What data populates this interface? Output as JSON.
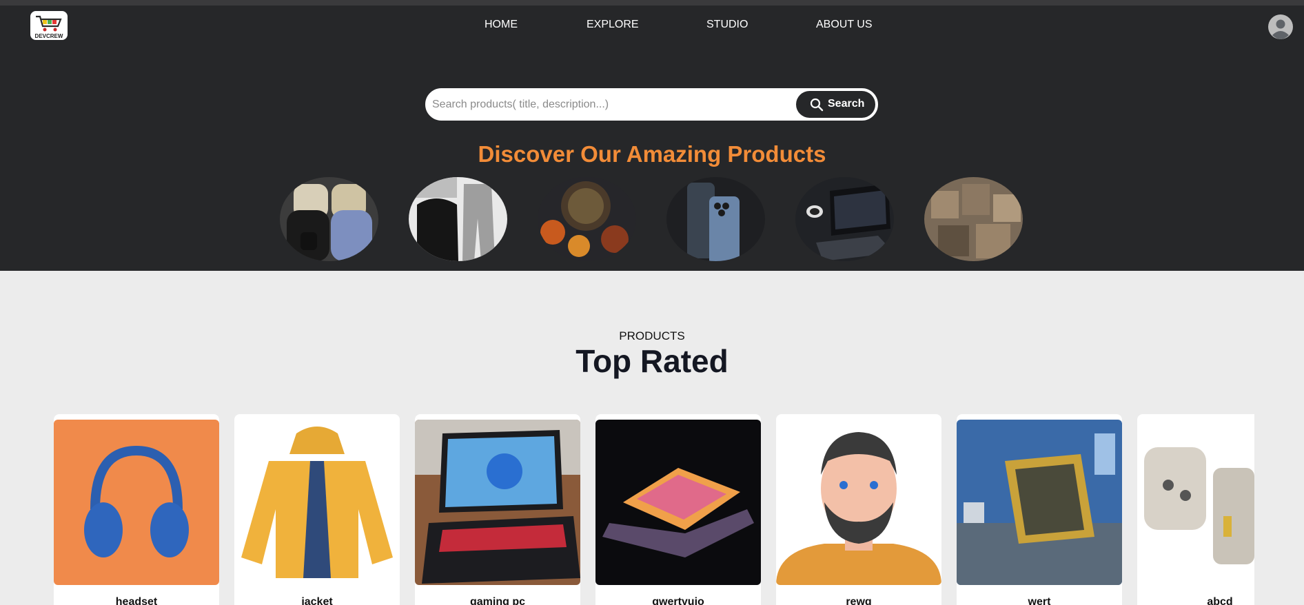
{
  "brand": {
    "logo_text": "DEVCREW"
  },
  "nav": {
    "items": [
      {
        "label": "HOME"
      },
      {
        "label": "EXPLORE"
      },
      {
        "label": "STUDIO"
      },
      {
        "label": "ABOUT US"
      }
    ]
  },
  "search": {
    "placeholder": "Search products( title, description...)",
    "button_label": "Search"
  },
  "hero": {
    "headline": "Discover Our Amazing Products"
  },
  "categories": [
    {
      "icon": "backpacks-image"
    },
    {
      "icon": "jacket-image"
    },
    {
      "icon": "food-image"
    },
    {
      "icon": "phones-image"
    },
    {
      "icon": "laptop-image"
    },
    {
      "icon": "boxes-image"
    }
  ],
  "products_section": {
    "label": "PRODUCTS",
    "title": "Top Rated",
    "items": [
      {
        "title": "headset",
        "icon": "headset-image"
      },
      {
        "title": "jacket",
        "icon": "jacket-image"
      },
      {
        "title": "gaming pc",
        "icon": "laptop-image"
      },
      {
        "title": "qwertyuio",
        "icon": "laptop-image"
      },
      {
        "title": "rewq",
        "icon": "avatar-image"
      },
      {
        "title": "wert",
        "icon": "cpu-socket-image"
      },
      {
        "title": "abcd",
        "icon": "adapter-image"
      }
    ]
  },
  "colors": {
    "header_bg": "#262729",
    "accent": "#f28c38",
    "page_bg": "#ececec"
  }
}
